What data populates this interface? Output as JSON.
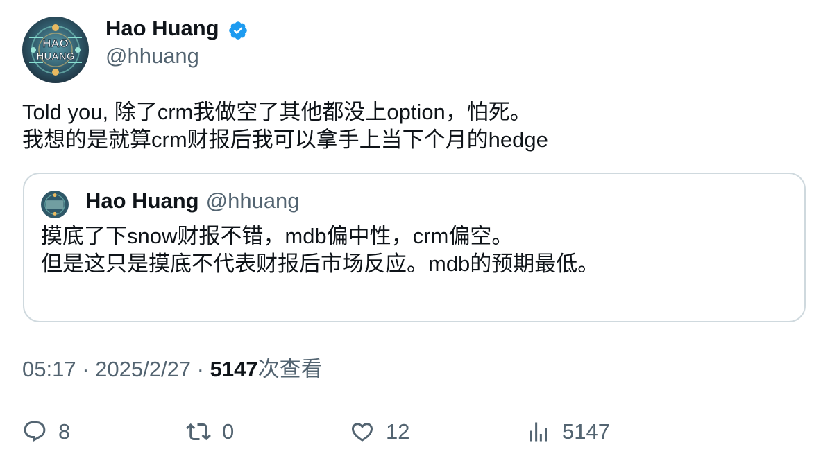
{
  "author": {
    "name": "Hao Huang",
    "handle": "@hhuang",
    "avatar_text_top": "HAO",
    "avatar_text_bottom": "HUANG",
    "avatar_icon": "avatar-logo",
    "verified_icon": "verified-badge-icon",
    "verified_color": "#1d9bf0"
  },
  "tweet": {
    "lines": [
      "Told you, 除了crm我做空了其他都没上option，怕死。",
      "我想的是就算crm财报后我可以拿手上当下个月的hedge"
    ]
  },
  "quote": {
    "name": "Hao Huang",
    "handle": "@hhuang",
    "lines": [
      "摸底了下snow财报不错，mdb偏中性，crm偏空。",
      "但是这只是摸底不代表财报后市场反应。mdb的预期最低。"
    ]
  },
  "meta": {
    "time": "05:17",
    "sep1": " · ",
    "date": "2025/2/27",
    "sep2": " · ",
    "views_count": "5147",
    "views_label": "次查看"
  },
  "actions": {
    "reply": {
      "icon": "reply-icon",
      "count": "8"
    },
    "retweet": {
      "icon": "retweet-icon",
      "count": "0"
    },
    "like": {
      "icon": "heart-icon",
      "count": "12"
    },
    "views": {
      "icon": "analytics-icon",
      "count": "5147"
    }
  },
  "colors": {
    "text": "#0f1419",
    "secondary": "#536471",
    "border": "#cfd9de",
    "brand": "#1d9bf0"
  }
}
